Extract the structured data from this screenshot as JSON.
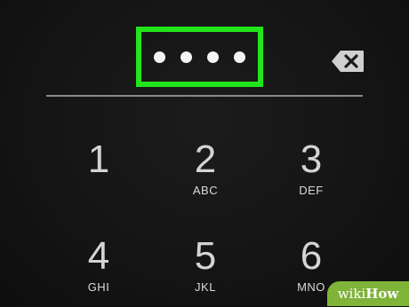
{
  "pin_entry": {
    "dots": [
      "•",
      "•",
      "•",
      "•"
    ],
    "highlight_color": "#22e51b",
    "backspace_icon": "backspace-icon"
  },
  "keypad": {
    "keys": [
      {
        "digit": "1",
        "letters": ""
      },
      {
        "digit": "2",
        "letters": "ABC"
      },
      {
        "digit": "3",
        "letters": "DEF"
      },
      {
        "digit": "4",
        "letters": "GHI"
      },
      {
        "digit": "5",
        "letters": "JKL"
      },
      {
        "digit": "6",
        "letters": "MNO"
      }
    ]
  },
  "watermark": {
    "prefix": "wiki",
    "suffix": "How"
  }
}
